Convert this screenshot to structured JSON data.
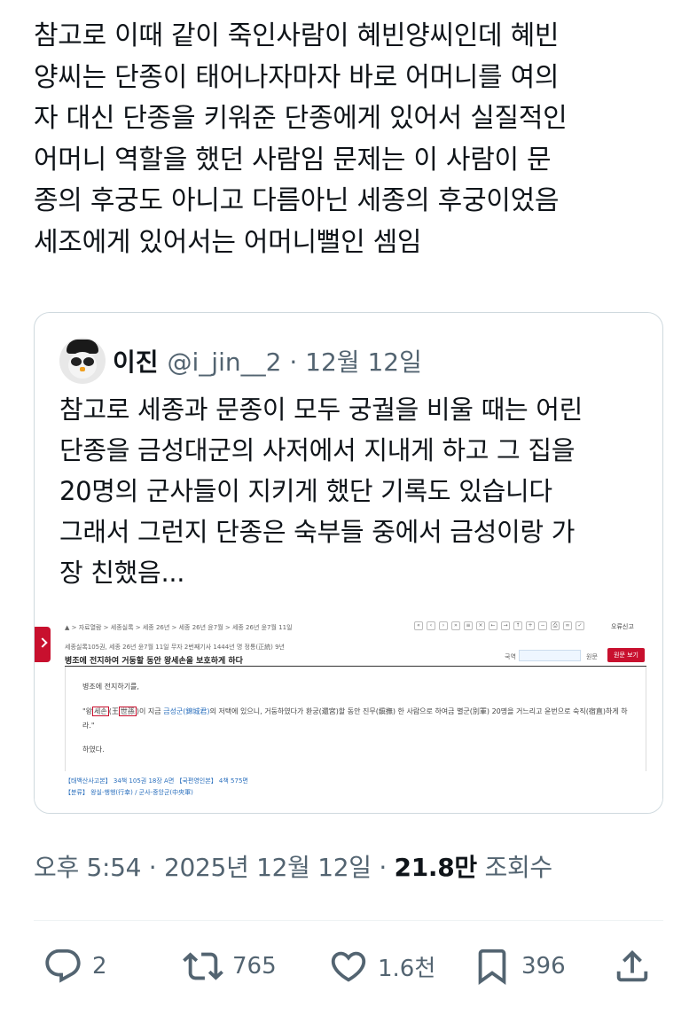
{
  "post": {
    "text": "참고로 이때 같이 죽인사람이 혜빈양씨인데 혜빈\n양씨는 단종이 태어나자마자 바로 어머니를 여의\n자 대신 단종을 키워준 단종에게 있어서 실질적인\n어머니 역할을 했던 사람임 문제는 이 사람이 문\n종의 후궁도 아니고 다름아닌 세종의 후궁이었음\n세조에게 있어서는 어머니뻘인 셈임"
  },
  "quote": {
    "author_name": "이진",
    "handle": "@i_jin__2",
    "separator": "·",
    "date": "12월 12일",
    "text": "참고로 세종과 문종이 모두 궁궐을 비울 때는 어린\n단종을 금성대군의 사저에서 지내게 하고 그 집을\n20명의 군사들이 지키게 했단 기록도 있습니다\n그래서 그런지 단종은 숙부들 중에서 금성이랑 가\n장 친했음...",
    "embed": {
      "breadcrumb": "▲ > 자료열람 > 세종실록 > 세종 26년 > 세종 26년 윤7월 > 세종 26년 윤7월 11일",
      "report": "오류신고",
      "subtitle": "세종실록105권, 세종 26년 윤7월 11일 무자 2번째기사   1444년 명 정통(正統) 9년",
      "title": "병조에 전지하여 거둥할 동안 왕세손을 보호하게 하다",
      "search_label": "국역",
      "orig_label": "원문",
      "btn_label": "원문 보기",
      "p1": "병조에 전지하기를,",
      "p2_a": "\"왕",
      "p2_box1": "세손",
      "p2_b": "(王",
      "p2_box2": "世孫",
      "p2_c": ")이 지금 ",
      "p2_link": "금성군(錦城君)",
      "p2_d": "의 저택에 있으니, 거둥하였다가 환궁(還宮)할 동안 진무(鎭撫) 한 사람으로 하여금 별군(別軍) 20명을 거느리고 윤번으로 숙직(宿直)하게 하라.\"",
      "p3": "하였다.",
      "ref1": "【태백산사고본】 34책 105권 18장 A면   【국편영인본】 4책 575면",
      "ref2": "【분류】 왕실-행행(行幸) / 군사-중앙군(中央軍)"
    }
  },
  "meta": {
    "time": "오후 5:54",
    "dot": " · ",
    "date": "2025년 12월 12일",
    "views": "21.8만",
    "views_label": " 조회수"
  },
  "actions": {
    "replies": "2",
    "reposts": "765",
    "likes": "1.6천",
    "bookmarks": "396"
  },
  "colors": {
    "text": "#0f1419",
    "secondary": "#536471",
    "border": "#cfd9de"
  }
}
